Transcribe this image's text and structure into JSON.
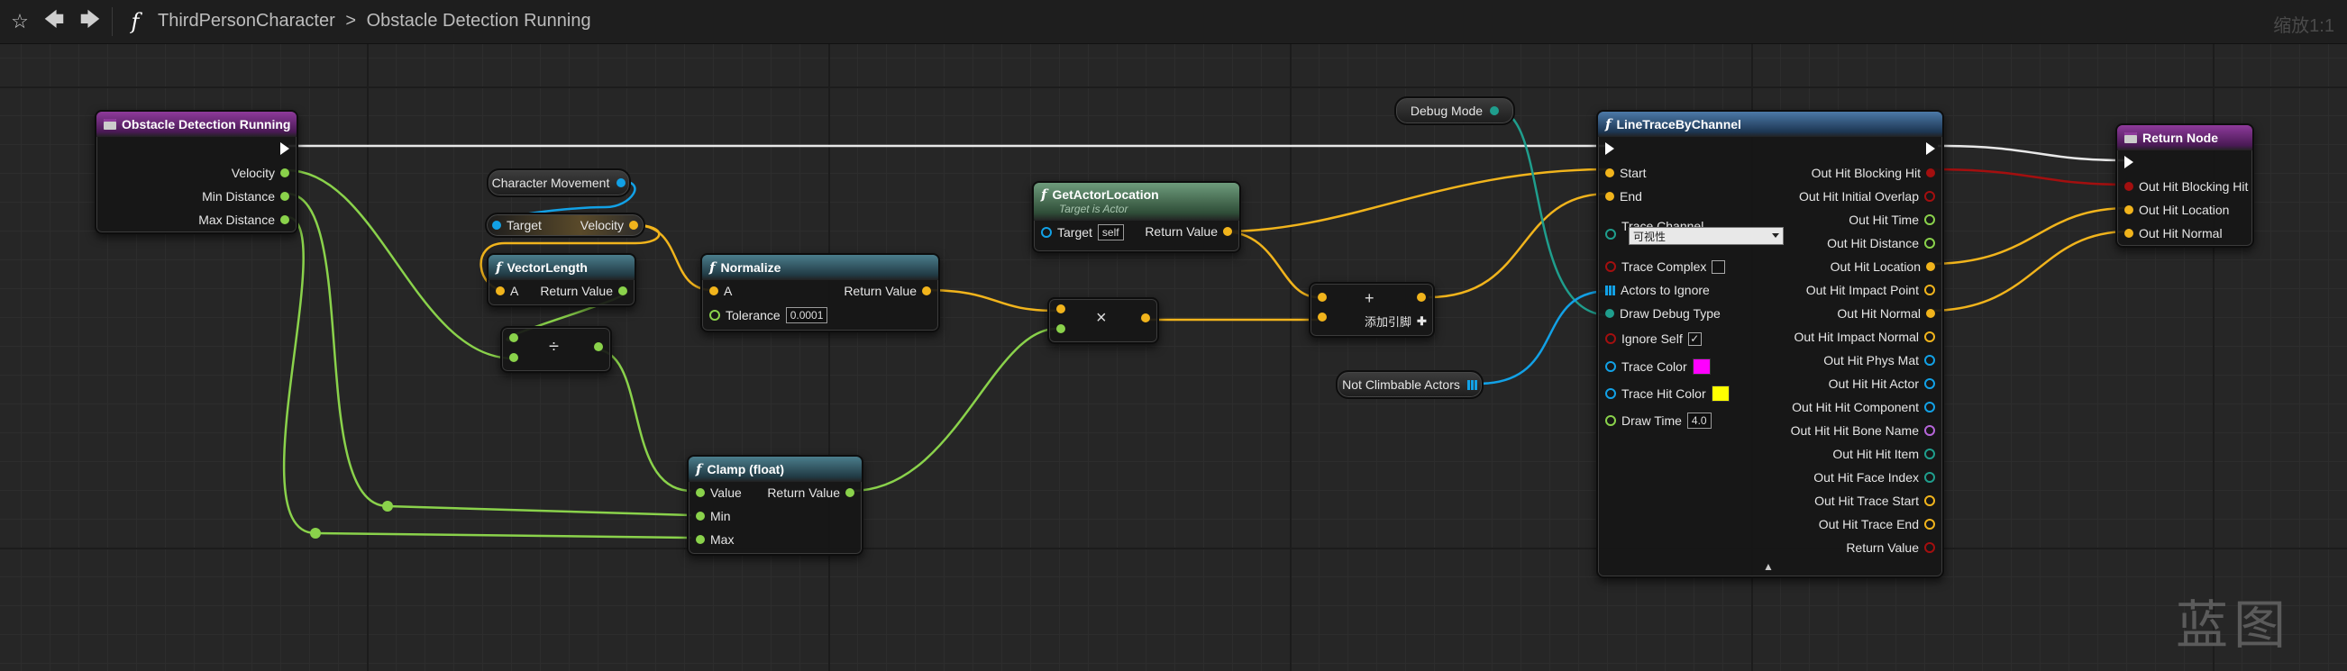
{
  "toolbar": {
    "breadcrumb_class": "ThirdPersonCharacter",
    "breadcrumb_sep": ">",
    "breadcrumb_function": "Obstacle Detection Running",
    "zoom_label": "缩放1:1"
  },
  "watermark": "蓝图",
  "nodes": {
    "entry": {
      "title": "Obstacle Detection Running",
      "pins": [
        "Velocity",
        "Min Distance",
        "Max Distance"
      ]
    },
    "char_movement": {
      "label": "Character Movement"
    },
    "get_velocity": {
      "target": "Target",
      "velocity": "Velocity"
    },
    "vector_length": {
      "title": "VectorLength",
      "in": "A",
      "out": "Return Value"
    },
    "divide": {
      "op": "÷"
    },
    "normalize": {
      "title": "Normalize",
      "in": "A",
      "out": "Return Value",
      "tolerance_label": "Tolerance",
      "tolerance_value": "0.0001"
    },
    "get_actor_location": {
      "title": "GetActorLocation",
      "subtitle": "Target is Actor",
      "target": "Target",
      "target_value": "self",
      "out": "Return Value"
    },
    "multiply": {
      "op": "×"
    },
    "add": {
      "op": "+",
      "add_pin": "添加引脚"
    },
    "clamp": {
      "title": "Clamp (float)",
      "value": "Value",
      "min": "Min",
      "max": "Max",
      "out": "Return Value"
    },
    "debug_mode": {
      "label": "Debug Mode"
    },
    "not_climbable": {
      "label": "Not Climbable Actors"
    },
    "line_trace": {
      "title": "LineTraceByChannel",
      "inputs": [
        "Start",
        "End",
        "Trace Channel",
        "Trace Complex",
        "Actors to Ignore",
        "Draw Debug Type",
        "Ignore Self",
        "Trace Color",
        "Trace Hit Color",
        "Draw Time"
      ],
      "trace_channel_value": "可视性",
      "trace_complex_checked": false,
      "ignore_self_checked": true,
      "ignore_self_mark": "✓",
      "trace_color": "#ff00ff",
      "trace_hit_color": "#ffff00",
      "draw_time": "4.0",
      "outputs": [
        "Out Hit Blocking Hit",
        "Out Hit Initial Overlap",
        "Out Hit Time",
        "Out Hit Distance",
        "Out Hit Location",
        "Out Hit Impact Point",
        "Out Hit Normal",
        "Out Hit Impact Normal",
        "Out Hit Phys Mat",
        "Out Hit Hit Actor",
        "Out Hit Hit Component",
        "Out Hit Hit Bone Name",
        "Out Hit Hit Item",
        "Out Hit Face Index",
        "Out Hit Trace Start",
        "Out Hit Trace End",
        "Return Value"
      ]
    },
    "return_node": {
      "title": "Return Node",
      "pins": [
        "Out Hit Blocking Hit",
        "Out Hit Location",
        "Out Hit Normal"
      ]
    }
  },
  "colors": {
    "float_pin": "#8ad24b",
    "vector_pin": "#f1b41c",
    "object_pin": "#12a1e6",
    "bool_pin": "#a30f0f",
    "enum_pin": "#1f9e8d",
    "exec_pin": "#ffffff"
  }
}
